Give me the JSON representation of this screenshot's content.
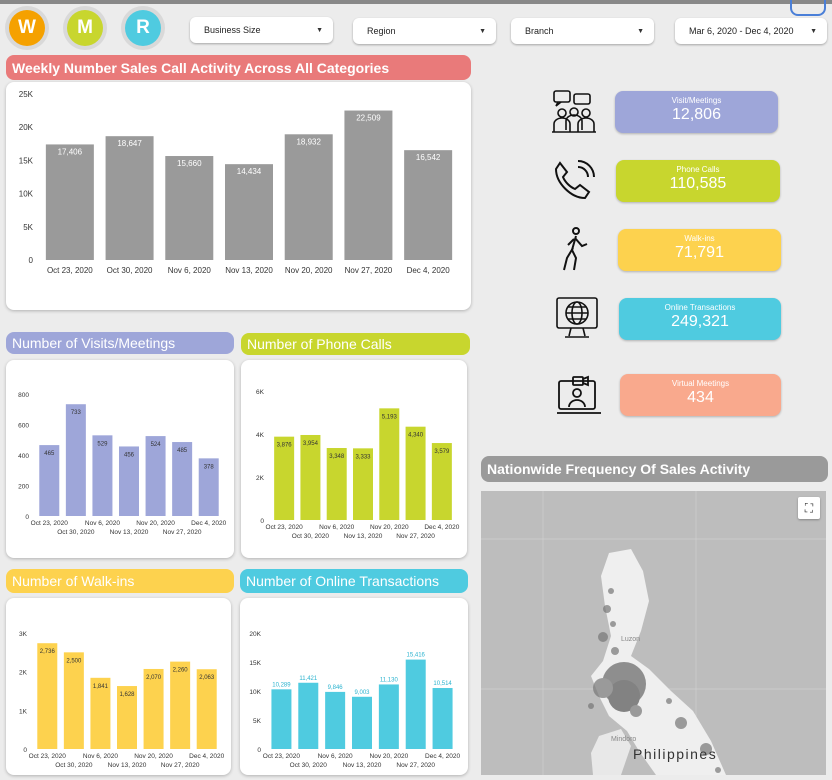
{
  "toggles": [
    {
      "letter": "W",
      "color": "#f5a100"
    },
    {
      "letter": "M",
      "color": "#c8d62e"
    },
    {
      "letter": "R",
      "color": "#4fcbe0"
    }
  ],
  "filters": {
    "business_size": "Business Size",
    "region": "Region",
    "branch": "Branch",
    "date_range": "Mar 6, 2020 - Dec 4, 2020"
  },
  "titles": {
    "weekly": "Weekly Number Sales Call Activity  Across All Categories",
    "visits": "Number of Visits/Meetings",
    "phone": "Number of Phone Calls",
    "walkins": "Number of Walk-ins",
    "online": "Number of Online Transactions",
    "map": "Nationwide Frequency Of Sales Activity"
  },
  "colors": {
    "weekly": "#9a9a9a",
    "visits": "#9ea6d9",
    "phone": "#c8d62e",
    "walkins": "#fdd24e",
    "online": "#4fcbe0",
    "virtual": "#f9a98d",
    "weekly_banner": "#e97a7a",
    "map_banner": "#9a9a9a"
  },
  "kpis": [
    {
      "label": "Visit/Meetings",
      "value": "12,806",
      "icon": "meeting-icon",
      "color": "#9ea6d9"
    },
    {
      "label": "Phone Calls",
      "value": "110,585",
      "icon": "phone-icon",
      "color": "#c8d62e"
    },
    {
      "label": "Walk-ins",
      "value": "71,791",
      "icon": "walking-person-icon",
      "color": "#fdd24e"
    },
    {
      "label": "Online Transactions",
      "value": "249,321",
      "icon": "online-globe-icon",
      "color": "#4fcbe0"
    },
    {
      "label": "Virtual Meetings",
      "value": "434",
      "icon": "virtual-meeting-icon",
      "color": "#f9a98d"
    }
  ],
  "map": {
    "country_label": "Philippines",
    "place_labels": [
      "Luzon",
      "Mindoro"
    ]
  },
  "chart_data": [
    {
      "id": "weekly",
      "type": "bar",
      "categories": [
        "Oct 23, 2020",
        "Oct 30, 2020",
        "Nov 6, 2020",
        "Nov 13, 2020",
        "Nov 20, 2020",
        "Nov 27, 2020",
        "Dec 4, 2020"
      ],
      "values": [
        17406,
        18647,
        15660,
        14434,
        18932,
        22509,
        16542
      ],
      "data_labels": [
        "17,406",
        "18,647",
        "15,660",
        "14,434",
        "18,932",
        "22,509",
        "16,542"
      ],
      "yticks": [
        0,
        5000,
        10000,
        15000,
        20000,
        25000
      ],
      "ytick_labels": [
        "0",
        "5K",
        "10K",
        "15K",
        "20K",
        "25K"
      ],
      "ylim": [
        0,
        25000
      ]
    },
    {
      "id": "visits",
      "type": "bar",
      "categories": [
        "Oct 23, 2020",
        "Oct 30, 2020",
        "Nov 6, 2020",
        "Nov 13, 2020",
        "Nov 20, 2020",
        "Nov 27, 2020",
        "Dec 4, 2020"
      ],
      "values": [
        465,
        733,
        529,
        456,
        524,
        485,
        378
      ],
      "data_labels": [
        "465",
        "733",
        "529",
        "456",
        "524",
        "485",
        "378"
      ],
      "yticks": [
        0,
        200,
        400,
        600,
        800
      ],
      "ytick_labels": [
        "0",
        "200",
        "400",
        "600",
        "800"
      ],
      "ylim": [
        0,
        800
      ]
    },
    {
      "id": "phone",
      "type": "bar",
      "categories": [
        "Oct 23, 2020",
        "Oct 30, 2020",
        "Nov 6, 2020",
        "Nov 13, 2020",
        "Nov 20, 2020",
        "Nov 27, 2020",
        "Dec 4, 2020"
      ],
      "values": [
        3876,
        3954,
        3348,
        3333,
        5193,
        4340,
        3579
      ],
      "data_labels": [
        "3,876",
        "3,954",
        "3,348",
        "3,333",
        "5,193",
        "4,340",
        "3,579"
      ],
      "yticks": [
        0,
        2000,
        4000,
        6000
      ],
      "ytick_labels": [
        "0",
        "2K",
        "4K",
        "6K"
      ],
      "ylim": [
        0,
        6000
      ]
    },
    {
      "id": "walkins",
      "type": "bar",
      "categories": [
        "Oct 23, 2020",
        "Oct 30, 2020",
        "Nov 6, 2020",
        "Nov 13, 2020",
        "Nov 20, 2020",
        "Nov 27, 2020",
        "Dec 4, 2020"
      ],
      "values": [
        2736,
        2500,
        1841,
        1628,
        2070,
        2260,
        2063
      ],
      "data_labels": [
        "2,736",
        "2,500",
        "1,841",
        "1,628",
        "2,070",
        "2,260",
        "2,063"
      ],
      "yticks": [
        0,
        1000,
        2000,
        3000
      ],
      "ytick_labels": [
        "0",
        "1K",
        "2K",
        "3K"
      ],
      "ylim": [
        0,
        3000
      ]
    },
    {
      "id": "online",
      "type": "bar",
      "categories": [
        "Oct 23, 2020",
        "Oct 30, 2020",
        "Nov 6, 2020",
        "Nov 13, 2020",
        "Nov 20, 2020",
        "Nov 27, 2020",
        "Dec 4, 2020"
      ],
      "values": [
        10289,
        11421,
        9846,
        9003,
        11130,
        15416,
        10514
      ],
      "data_labels": [
        "10,289",
        "11,421",
        "9,846",
        "9,003",
        "11,130",
        "15,416",
        "10,514"
      ],
      "yticks": [
        0,
        5000,
        10000,
        15000,
        20000
      ],
      "ytick_labels": [
        "0",
        "5K",
        "10K",
        "15K",
        "20K"
      ],
      "ylim": [
        0,
        20000
      ]
    }
  ]
}
